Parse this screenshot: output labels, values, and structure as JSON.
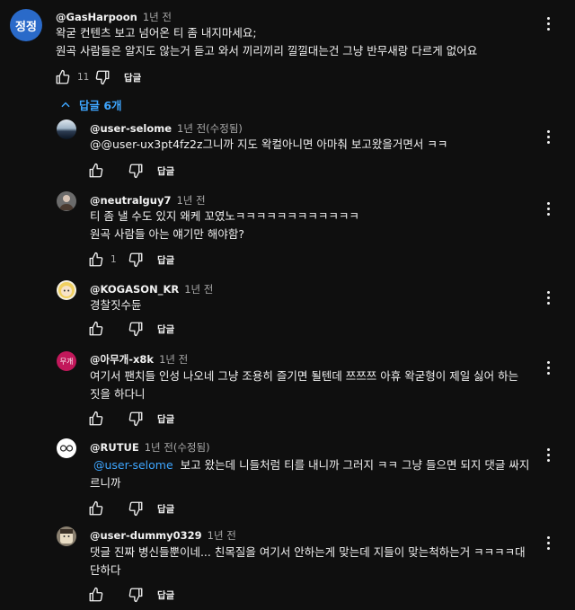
{
  "main_comment": {
    "avatar_text": "정정",
    "avatar_color": "#2a6ac9",
    "author": "@GasHarpoon",
    "time": "1년 전",
    "lines": [
      "왁굳 컨텐츠 보고 넘어온 티 좀 내지마세요;",
      "원곡 사람들은 알지도 않는거 듣고 와서 끼리끼리 낄낄대는건 그냥 반무새랑 다르게 없어요"
    ],
    "likes": "11",
    "reply_label": "답글"
  },
  "replies_toggle": {
    "label": "답글 6개",
    "icon": "chevron-up-icon"
  },
  "replies": [
    {
      "author": "@user-selome",
      "time": "1년 전(수정됨)",
      "lines": [
        "@@user-ux3pt4fz2z그니까 지도 왁컬아니면 아마춰 보고왔을거면서 ㅋㅋ"
      ],
      "likes": "",
      "reply_label": "답글"
    },
    {
      "author": "@neutralguy7",
      "time": "1년 전",
      "lines": [
        "티 좀 낼 수도 있지 왜케 꼬였노ㅋㅋㅋㅋㅋㅋㅋㅋㅋㅋㅋㅋ",
        "원곡 사람들 아는 얘기만 해야함?"
      ],
      "likes": "1",
      "reply_label": "답글"
    },
    {
      "author": "@KOGASON_KR",
      "time": "1년 전",
      "lines": [
        "경찰짓수듄"
      ],
      "likes": "",
      "reply_label": "답글"
    },
    {
      "author": "@아무개-x8k",
      "time": "1년 전",
      "avatar_text": "무개",
      "avatar_color": "#c2185b",
      "lines": [
        "여기서 팬치들 인성 나오네 그냥 조용히 즐기면 될텐데 쯔쯔쯔 아휴 왁굳형이 제일 싫어 하는",
        "짓을 하다니"
      ],
      "likes": "",
      "reply_label": "답글"
    },
    {
      "author": "@RUTUE",
      "time": "1년 전(수정됨)",
      "mention": "@user-selome",
      "lines": [
        "보고 왔는데 니들처럼 티를 내니까 그러지 ㅋㅋ 그냥 들으면 되지 댓글 싸지",
        "르니까"
      ],
      "likes": "",
      "reply_label": "답글"
    },
    {
      "author": "@user-dummy0329",
      "time": "1년 전",
      "lines": [
        "댓글 진짜 병신들뿐이네... 친목질을 여기서 안하는게 맞는데 지들이 맞는척하는거 ㅋㅋㅋㅋ대",
        "단하다"
      ],
      "likes": "",
      "reply_label": "답글"
    }
  ],
  "colors": {
    "background": "#0f0f0f",
    "text": "#f1f1f1",
    "secondary_text": "#aaaaaa",
    "link": "#3ea6ff"
  }
}
